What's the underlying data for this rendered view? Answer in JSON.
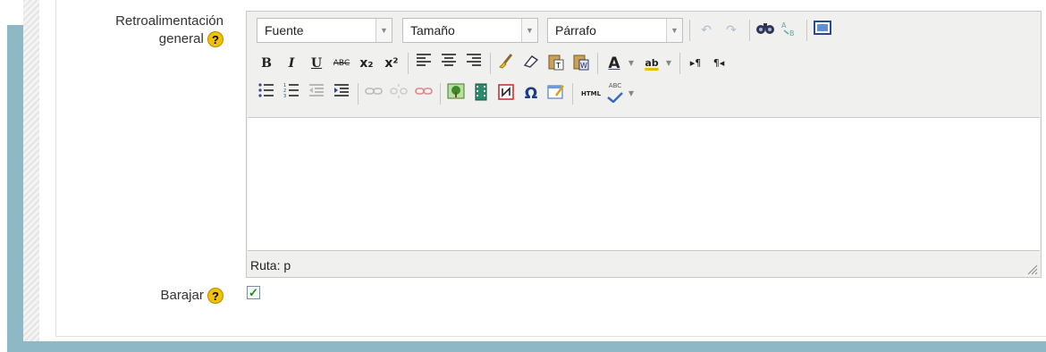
{
  "fields": {
    "feedback": {
      "label_line1": "Retroalimentación",
      "label_line2": "general",
      "help": "?"
    },
    "shuffle": {
      "label": "Barajar",
      "help": "?",
      "checked": true
    }
  },
  "editor": {
    "font_select": "Fuente",
    "size_select": "Tamaño",
    "format_select": "Párrafo",
    "path_label": "Ruta: p",
    "toolbar_row1": [
      "undo-icon",
      "redo-icon",
      "find-icon",
      "replace-icon",
      "fullscreen-icon"
    ],
    "toolbar_row2": [
      "bold",
      "italic",
      "underline",
      "strikethrough",
      "subscript",
      "superscript",
      "align-left",
      "align-center",
      "align-right",
      "cleanup",
      "remove-format",
      "paste-text",
      "paste-word",
      "text-color",
      "highlight-color",
      "ltr",
      "rtl"
    ],
    "toolbar_row3": [
      "bullet-list",
      "numbered-list",
      "outdent",
      "indent",
      "link",
      "unlink",
      "anchor",
      "image",
      "media",
      "nonbreaking",
      "special-char",
      "template",
      "html-source",
      "spellcheck"
    ],
    "labels": {
      "bold": "B",
      "italic": "I",
      "underline": "U",
      "strike": "ABC",
      "sub": "x₂",
      "sup": "x²",
      "omega": "Ω",
      "html": "HTML",
      "abc": "ABC",
      "text_color": "A",
      "highlight": "ab"
    }
  },
  "colors": {
    "accent": "#8eb8c6",
    "help_badge": "#f2c200",
    "check": "#1a8a1a"
  }
}
